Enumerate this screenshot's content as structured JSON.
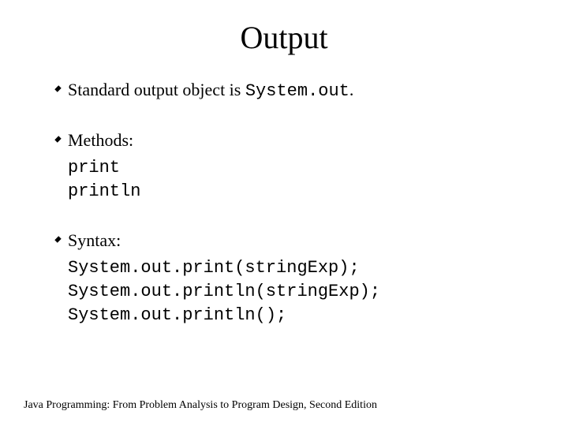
{
  "title": "Output",
  "bullets": {
    "b1_prefix": "Standard output object is ",
    "b1_code": "System.out",
    "b1_suffix": ".",
    "b2_label": "Methods:",
    "b2_m1": "print",
    "b2_m2": "println",
    "b3_label": "Syntax:",
    "b3_s1": "System.out.print(stringExp);",
    "b3_s2": "System.out.println(stringExp);",
    "b3_s3": "System.out.println();"
  },
  "footer": "Java Programming: From Problem Analysis to Program Design, Second Edition"
}
